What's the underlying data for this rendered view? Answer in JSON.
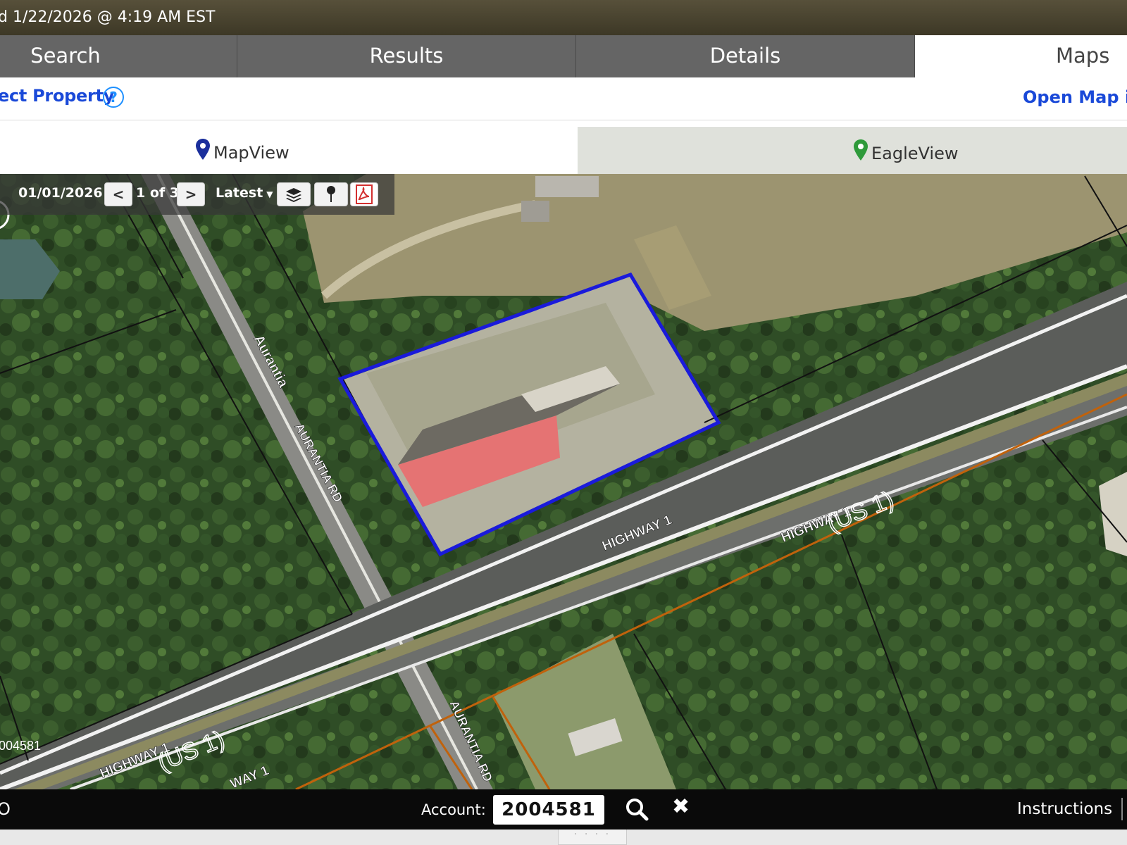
{
  "header": {
    "updated_text": "d 1/22/2026 @ 4:19 AM EST"
  },
  "tabs": [
    {
      "label": "Search"
    },
    {
      "label": "Results"
    },
    {
      "label": "Details"
    },
    {
      "label": "Maps",
      "active": true
    }
  ],
  "links": {
    "select_property": "ect Property",
    "help_symbol": "?",
    "open_map": "Open Map in"
  },
  "view_tabs": [
    {
      "label": "MapView",
      "pin_color": "#1b2f9c"
    },
    {
      "label": "EagleView",
      "pin_color": "#2e9a3a",
      "active": true
    }
  ],
  "map_toolbar": {
    "date": "01/01/2026",
    "count": "1 of 3",
    "latest": "Latest",
    "prev_symbol": "<",
    "next_symbol": ">"
  },
  "map": {
    "parcel_outline_color": "#1a1adb",
    "labels": {
      "aurantia_top": "Aurantia",
      "aurantia_rd_1": "AURANTIA RD",
      "aurantia_rd_2": "AURANTIA RD",
      "highway1_a": "HIGHWAY 1",
      "highway1_b": "HIGHWAY 1",
      "highway1_c": "HIGHWAY 1",
      "highway1_d": "WAY 1",
      "us1_a": "(US 1)",
      "us1_b": "(US 1)",
      "parcel_id": "004581"
    }
  },
  "bottom_bar": {
    "left_text": "O",
    "account_label": "Account:",
    "account_value": "2004581",
    "clear_symbol": "✖",
    "instructions": "Instructions"
  },
  "footer": {
    "grip": "· · · ·"
  }
}
